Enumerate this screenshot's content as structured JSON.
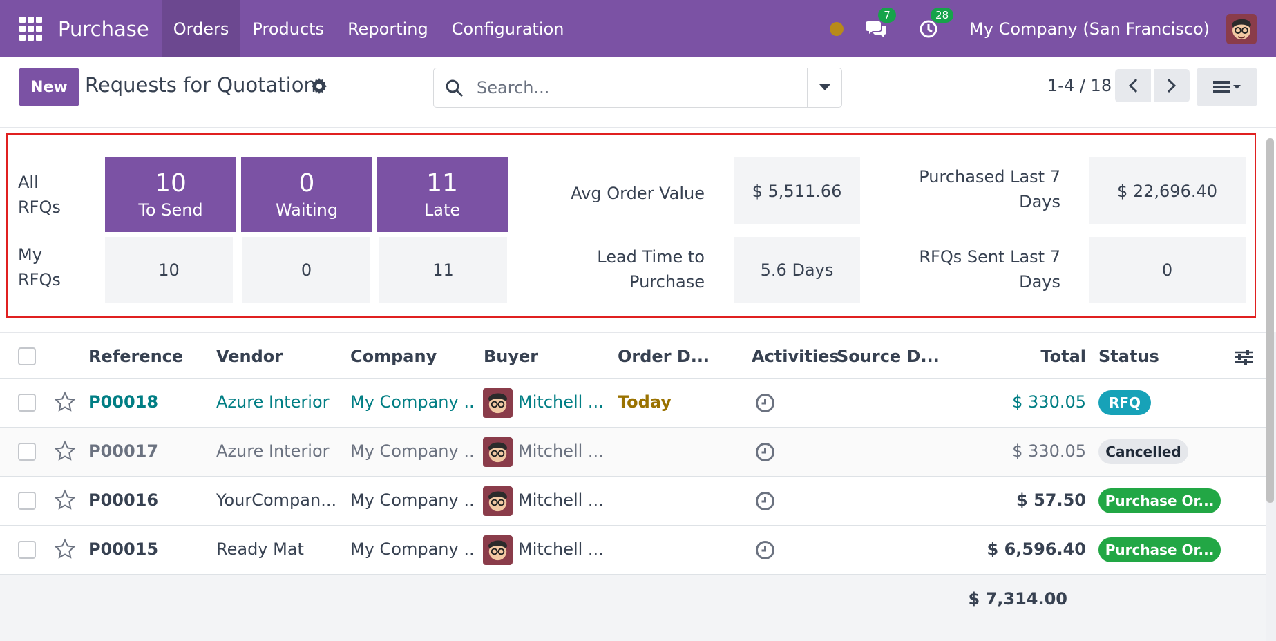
{
  "navbar": {
    "app_name": "Purchase",
    "menu": [
      "Orders",
      "Products",
      "Reporting",
      "Configuration"
    ],
    "messages_count": "7",
    "activities_count": "28",
    "company": "My Company (San Francisco)"
  },
  "control": {
    "new_label": "New",
    "title": "Requests for Quotation",
    "search_placeholder": "Search...",
    "pager": "1-4 / 18"
  },
  "dashboard": {
    "all_label": "All RFQs",
    "my_label": "My RFQs",
    "tiles": [
      {
        "num": "10",
        "label": "To Send",
        "my": "10"
      },
      {
        "num": "0",
        "label": "Waiting",
        "my": "0"
      },
      {
        "num": "11",
        "label": "Late",
        "my": "11"
      }
    ],
    "avg_order_label": "Avg Order Value",
    "avg_order_value": "$ 5,511.66",
    "lead_time_label": "Lead Time to Purchase",
    "lead_time_value": "5.6 Days",
    "purchased_label": "Purchased Last 7 Days",
    "purchased_value": "$ 22,696.40",
    "rfq_sent_label": "RFQs Sent Last 7 Days",
    "rfq_sent_value": "0"
  },
  "table": {
    "headers": {
      "reference": "Reference",
      "vendor": "Vendor",
      "company": "Company",
      "buyer": "Buyer",
      "order_date": "Order D...",
      "activities": "Activities",
      "source": "Source D...",
      "total": "Total",
      "status": "Status"
    },
    "rows": [
      {
        "ref": "P00018",
        "vendor": "Azure Interior",
        "company": "My Company ...",
        "buyer": "Mitchell ...",
        "order_date": "Today",
        "total": "$ 330.05",
        "status": "RFQ"
      },
      {
        "ref": "P00017",
        "vendor": "Azure Interior",
        "company": "My Company ...",
        "buyer": "Mitchell ...",
        "order_date": "",
        "total": "$ 330.05",
        "status": "Cancelled"
      },
      {
        "ref": "P00016",
        "vendor": "YourCompan...",
        "company": "My Company ...",
        "buyer": "Mitchell ...",
        "order_date": "",
        "total": "$ 57.50",
        "status": "Purchase Or..."
      },
      {
        "ref": "P00015",
        "vendor": "Ready Mat",
        "company": "My Company ...",
        "buyer": "Mitchell ...",
        "order_date": "",
        "total": "$ 6,596.40",
        "status": "Purchase Or..."
      }
    ],
    "grand_total": "$ 7,314.00"
  },
  "colors": {
    "brand": "#7b52a4",
    "link": "#017e84",
    "rfq_status": "#17a2b8",
    "purchase_status": "#22a745",
    "highlight_frame": "#e02020"
  }
}
